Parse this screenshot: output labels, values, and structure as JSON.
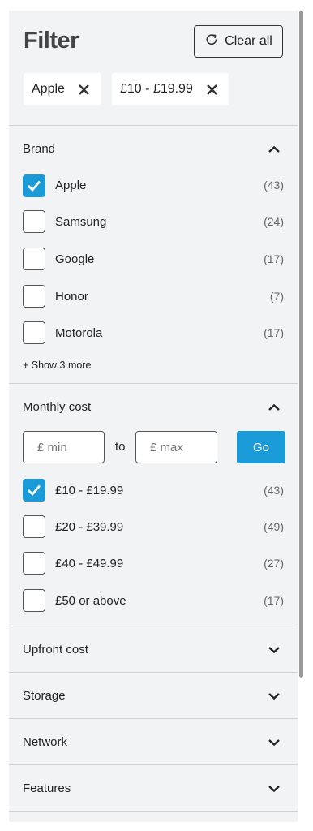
{
  "header": {
    "title": "Filter",
    "clear_all_label": "Clear all"
  },
  "active_filters": [
    {
      "label": "Apple"
    },
    {
      "label": "£10 - £19.99"
    }
  ],
  "brand": {
    "title": "Brand",
    "expanded": true,
    "options": [
      {
        "label": "Apple",
        "count": "(43)",
        "checked": true
      },
      {
        "label": "Samsung",
        "count": "(24)",
        "checked": false
      },
      {
        "label": "Google",
        "count": "(17)",
        "checked": false
      },
      {
        "label": "Honor",
        "count": "(7)",
        "checked": false
      },
      {
        "label": "Motorola",
        "count": "(17)",
        "checked": false
      }
    ],
    "show_more_label": "+ Show 3 more"
  },
  "monthly_cost": {
    "title": "Monthly cost",
    "expanded": true,
    "min_placeholder": "£ min",
    "to_label": "to",
    "max_placeholder": "£ max",
    "go_label": "Go",
    "options": [
      {
        "label": "£10 - £19.99",
        "count": "(43)",
        "checked": true
      },
      {
        "label": "£20 - £39.99",
        "count": "(49)",
        "checked": false
      },
      {
        "label": "£40 - £49.99",
        "count": "(27)",
        "checked": false
      },
      {
        "label": "£50 or above",
        "count": "(17)",
        "checked": false
      }
    ]
  },
  "collapsed_sections": [
    {
      "title": "Upfront cost"
    },
    {
      "title": "Storage"
    },
    {
      "title": "Network"
    },
    {
      "title": "Features"
    }
  ],
  "icons": {
    "clear": "refresh-icon",
    "remove": "close-icon",
    "check": "checkmark-icon",
    "expand": "chevron-down-icon",
    "collapse": "chevron-up-icon"
  },
  "colors": {
    "accent": "#1a9ad6",
    "panel_background": "#f2f3f4"
  }
}
